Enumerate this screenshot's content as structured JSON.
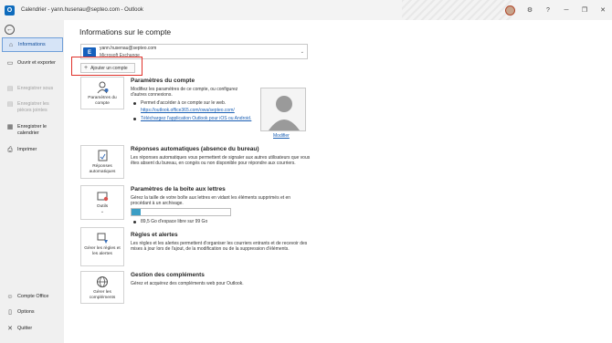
{
  "window": {
    "title": "Calendrier - yann.husenau@septeo.com - Outlook"
  },
  "sidebar": {
    "items": [
      {
        "label": "Informations",
        "icon": "home-icon"
      },
      {
        "label": "Ouvrir et exporter",
        "icon": "folder-open-icon"
      },
      {
        "label": "Enregistrer sous",
        "icon": "save-as-icon"
      },
      {
        "label": "Enregistrer les pièces jointes",
        "icon": "attachment-save-icon"
      },
      {
        "label": "Enregistrer le calendrier",
        "icon": "calendar-save-icon"
      },
      {
        "label": "Imprimer",
        "icon": "printer-icon"
      }
    ],
    "footer": [
      {
        "label": "Compte Office",
        "icon": "user-icon"
      },
      {
        "label": "Options",
        "icon": "options-icon"
      },
      {
        "label": "Quitter",
        "icon": "close-icon"
      }
    ]
  },
  "main": {
    "title": "Informations sur le compte",
    "account": {
      "email": "yann.husenau@septeo.com",
      "type": "Microsoft Exchange"
    },
    "add_account_label": "Ajouter un compte",
    "account_settings": {
      "tile_label": "Paramètres du compte",
      "title": "Paramètres du compte",
      "description": "Modifiez les paramètres de ce compte, ou configurez d'autres connexions.",
      "bullet": "Permet d'accéder à ce compte sur le web.",
      "web_link": "https://outlook.office365.com/owa/septeo.com/",
      "mobile_link": "Téléchargez l'application Outlook pour iOS ou Android.",
      "modify_label": "Modifier"
    },
    "auto_replies": {
      "tile_label": "Réponses automatiques",
      "title": "Réponses automatiques (absence du bureau)",
      "description": "Les réponses automatiques vous permettent de signaler aux autres utilisateurs que vous êtes absent du bureau, en congés ou non disponible pour répondre aux courriers."
    },
    "mailbox_settings": {
      "tile_label": "Outils",
      "title": "Paramètres de la boîte aux lettres",
      "description": "Gérez la taille de votre boîte aux lettres en vidant les éléments supprimés et en procédant à un archivage.",
      "storage_text": "89,5 Go d'espace libre sur 99 Go",
      "storage_used_fraction": 0.096
    },
    "rules": {
      "tile_label": "Gérer les règles et les alertes",
      "title": "Règles et alertes",
      "description": "Les règles et les alertes permettent d'organiser les courriers entrants et de recevoir des mises à jour lors de l'ajout, de la modification ou de la suppression d'éléments."
    },
    "addins": {
      "tile_label": "Gérer les compléments",
      "title": "Gestion des compléments",
      "description": "Gérez et acquérez des compléments web pour Outlook."
    }
  },
  "colors": {
    "accent": "#0f6cbd",
    "highlight": "#e0312a",
    "link": "#1a5fb4",
    "storage": "#3b9ec5"
  }
}
